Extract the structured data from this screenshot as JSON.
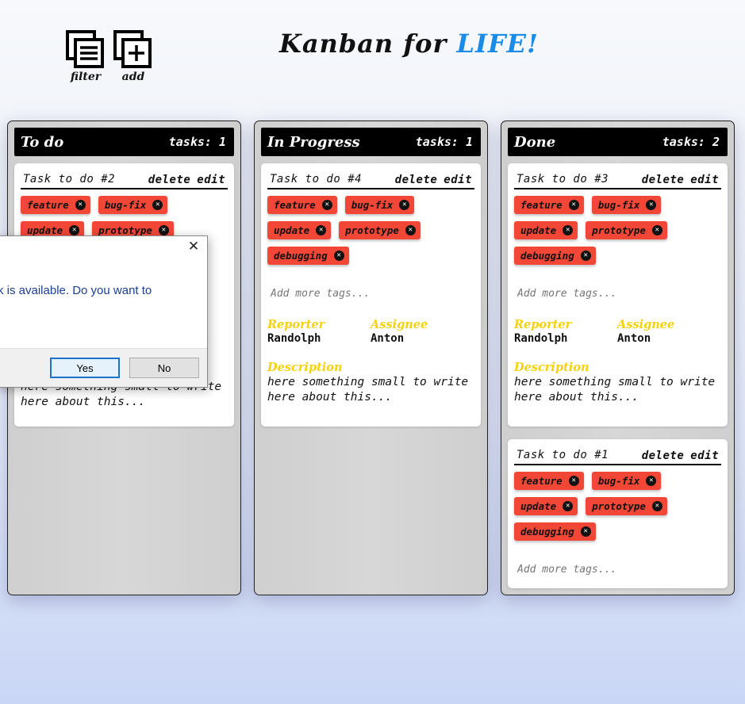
{
  "header": {
    "title_prefix": "Kanban for ",
    "title_accent": "LIFE!",
    "filter_label": "filter",
    "add_label": "add",
    "filter_icon": "list-stack-icon",
    "add_icon": "plus-stack-icon",
    "accent_color": "#1a8ce8"
  },
  "columns": [
    {
      "name": "To do",
      "count": "tasks: 1",
      "cards": [
        {
          "title": "Task to do #2",
          "delete": "delete",
          "edit": "edit",
          "tags": [
            "feature",
            "bug-fix",
            "update",
            "prototype"
          ],
          "tag_placeholder": "",
          "reporter_label": "",
          "reporter": "",
          "assignee_label": "",
          "assignee": "",
          "description_label": "",
          "description": "here something small to write here about this..."
        }
      ]
    },
    {
      "name": "In Progress",
      "count": "tasks: 1",
      "cards": [
        {
          "title": "Task to do #4",
          "delete": "delete",
          "edit": "edit",
          "tags": [
            "feature",
            "bug-fix",
            "update",
            "prototype",
            "debugging"
          ],
          "tag_placeholder": "Add more tags...",
          "reporter_label": "Reporter",
          "reporter": "Randolph",
          "assignee_label": "Assignee",
          "assignee": "Anton",
          "description_label": "Description",
          "description": "here something small to write here about this..."
        }
      ]
    },
    {
      "name": "Done",
      "count": "tasks: 2",
      "cards": [
        {
          "title": "Task to do #3",
          "delete": "delete",
          "edit": "edit",
          "tags": [
            "feature",
            "bug-fix",
            "update",
            "prototype",
            "debugging"
          ],
          "tag_placeholder": "Add more tags...",
          "reporter_label": "Reporter",
          "reporter": "Randolph",
          "assignee_label": "Assignee",
          "assignee": "Anton",
          "description_label": "Description",
          "description": "here something small to write here about this..."
        },
        {
          "title": "Task to do #1",
          "delete": "delete",
          "edit": "edit",
          "tags": [
            "feature",
            "bug-fix",
            "update",
            "prototype",
            "debugging"
          ],
          "tag_placeholder": "Add more tags..."
        }
      ]
    }
  ],
  "dialog": {
    "message": "k is available. Do you want to",
    "yes": "Yes",
    "no": "No",
    "close_icon": "close-icon"
  },
  "colors": {
    "tag_bg": "#f24637",
    "label_yellow": "#f5d20a",
    "dialog_text": "#1b3f93"
  }
}
